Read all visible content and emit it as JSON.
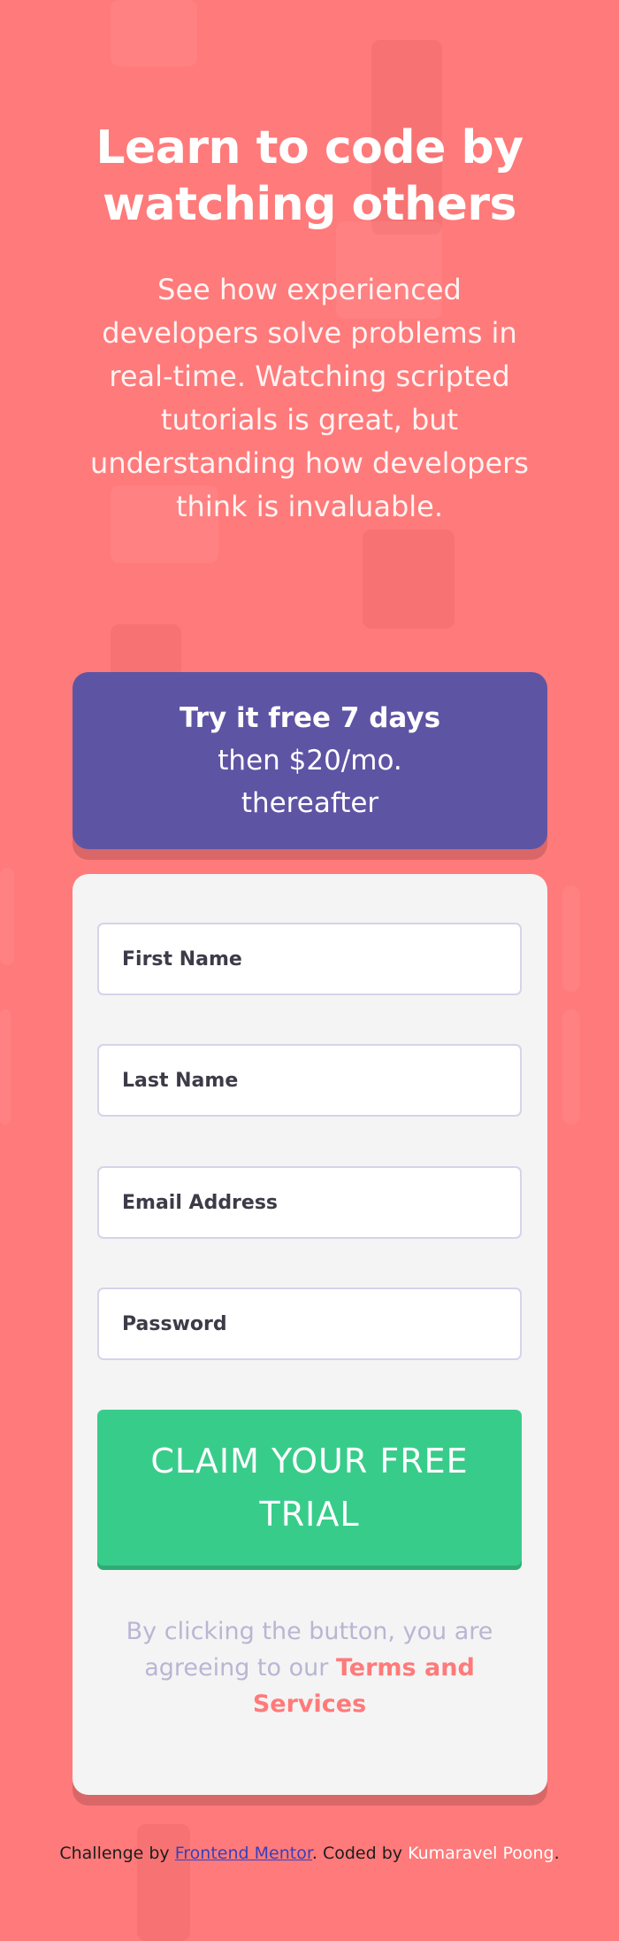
{
  "hero": {
    "title": "Learn to code by watching others",
    "description": "See how experienced developers solve problems in real-time. Watching scripted tutorials is great, but understanding how developers think is invaluable."
  },
  "offer": {
    "highlight": "Try it free 7 days",
    "rest": "then $20/mo. thereafter"
  },
  "form": {
    "first_name_placeholder": "First Name",
    "last_name_placeholder": "Last Name",
    "email_placeholder": "Email Address",
    "password_placeholder": "Password",
    "first_name_value": "",
    "last_name_value": "",
    "email_value": "",
    "password_value": "",
    "submit_label": "CLAIM YOUR FREE TRIAL",
    "terms_prefix": "By clicking the button, you are agreeing to our",
    "terms_link": "Terms and Services"
  },
  "footer": {
    "prefix": "Challenge by",
    "mentor_link": "Frontend Mentor",
    "middle": ". Coded by",
    "author": "Kumaravel Poong",
    "suffix": "."
  },
  "colors": {
    "background": "#ff7a7a",
    "offer_bg": "#5e54a4",
    "button_bg": "#38cc8b",
    "card_bg": "#f4f4f4",
    "link_red": "#ff7a7a"
  }
}
